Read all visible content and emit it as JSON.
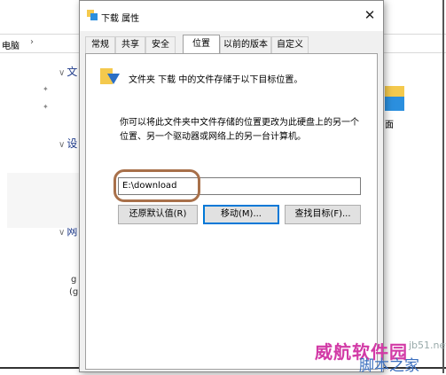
{
  "explorer": {
    "address_label": "电脑",
    "group1_label": "文",
    "group2_label": "设",
    "group3_label": "网",
    "right_label": "面",
    "frag1": "g",
    "frag2": "(g"
  },
  "dialog": {
    "title": "下载 属性",
    "close_glyph": "✕",
    "tabs": [
      "常规",
      "共享",
      "安全",
      "位置",
      "以前的版本",
      "自定义"
    ],
    "active_tab": "位置",
    "info_line": "文件夹 下载 中的文件存储于以下目标位置。",
    "desc_line1": "你可以将此文件夹中文件存储的位置更改为此硬盘上的另一个",
    "desc_line2": "位置、另一个驱动器或网络上的另一台计算机。",
    "path_value": "E:\\download",
    "buttons": {
      "restore": "还原默认值(R)",
      "move": "移动(M)...",
      "find": "查找目标(F)..."
    }
  },
  "watermark": {
    "site": "jb51.net",
    "main": "威航软件园",
    "sub": "脚本之家"
  },
  "colors": {
    "highlight": "#a8704a",
    "folder_yellow": "#f4c94d",
    "folder_blue": "#2b6fc5",
    "watermark_pink": "#d23aa6",
    "watermark_blue": "#3b6fbf"
  }
}
